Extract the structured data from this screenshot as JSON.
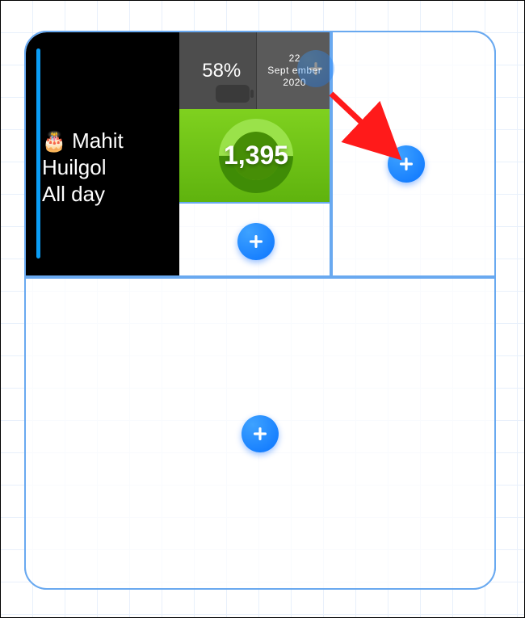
{
  "calendar": {
    "emoji": "🎂",
    "title_line1": "Mahit",
    "title_line2": "Huilgol",
    "subtitle": "All day"
  },
  "battery": {
    "percent_label": "58%"
  },
  "date": {
    "day": "22",
    "month": "Sept ember",
    "year": "2020"
  },
  "steps": {
    "value": "1,395"
  },
  "icons": {
    "add": "plus-icon"
  }
}
